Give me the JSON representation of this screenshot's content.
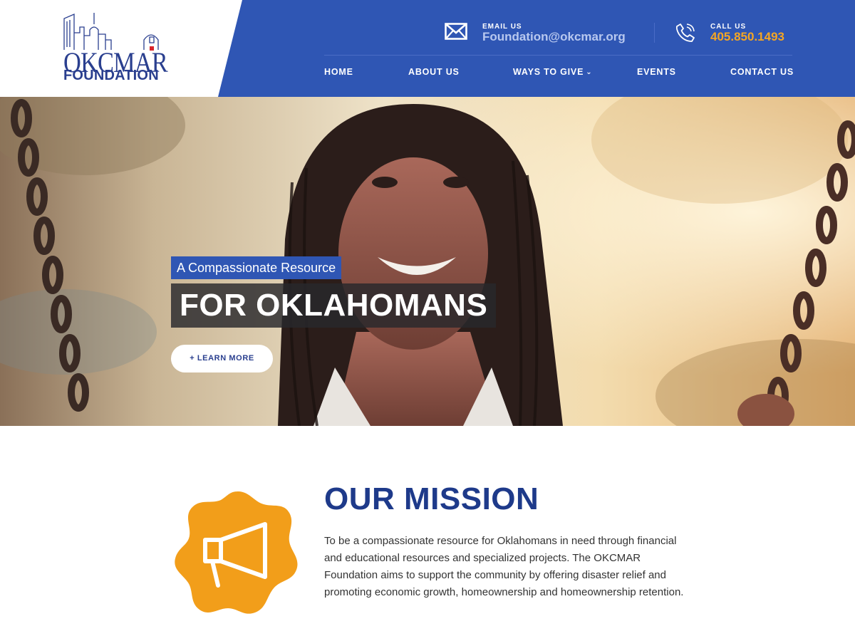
{
  "brand": {
    "logo_line1": "OKCMAR",
    "logo_line2": "FOUNDATION",
    "primary_color": "#2f56b4",
    "accent_color": "#f5a623",
    "title_color": "#1e3a8a"
  },
  "header": {
    "email": {
      "label": "EMAIL US",
      "value": "Foundation@okcmar.org",
      "icon": "envelope-icon"
    },
    "phone": {
      "label": "CALL US",
      "value": "405.850.1493",
      "icon": "phone-icon"
    }
  },
  "nav": {
    "items": [
      {
        "label": "HOME"
      },
      {
        "label": "ABOUT US"
      },
      {
        "label": "WAYS TO GIVE",
        "has_dropdown": true
      },
      {
        "label": "EVENTS"
      },
      {
        "label": "CONTACT US"
      }
    ]
  },
  "hero": {
    "tagline": "A Compassionate Resource",
    "heading": "FOR OKLAHOMANS",
    "cta_label": "+ LEARN MORE"
  },
  "mission": {
    "icon": "megaphone-icon",
    "title": "OUR MISSION",
    "body": "To be a compassionate resource for Oklahomans in need through financial and educational resources and specialized projects.  The OKCMAR Foundation aims to support the community by offering disaster relief and promoting economic growth, homeownership and homeownership retention."
  }
}
